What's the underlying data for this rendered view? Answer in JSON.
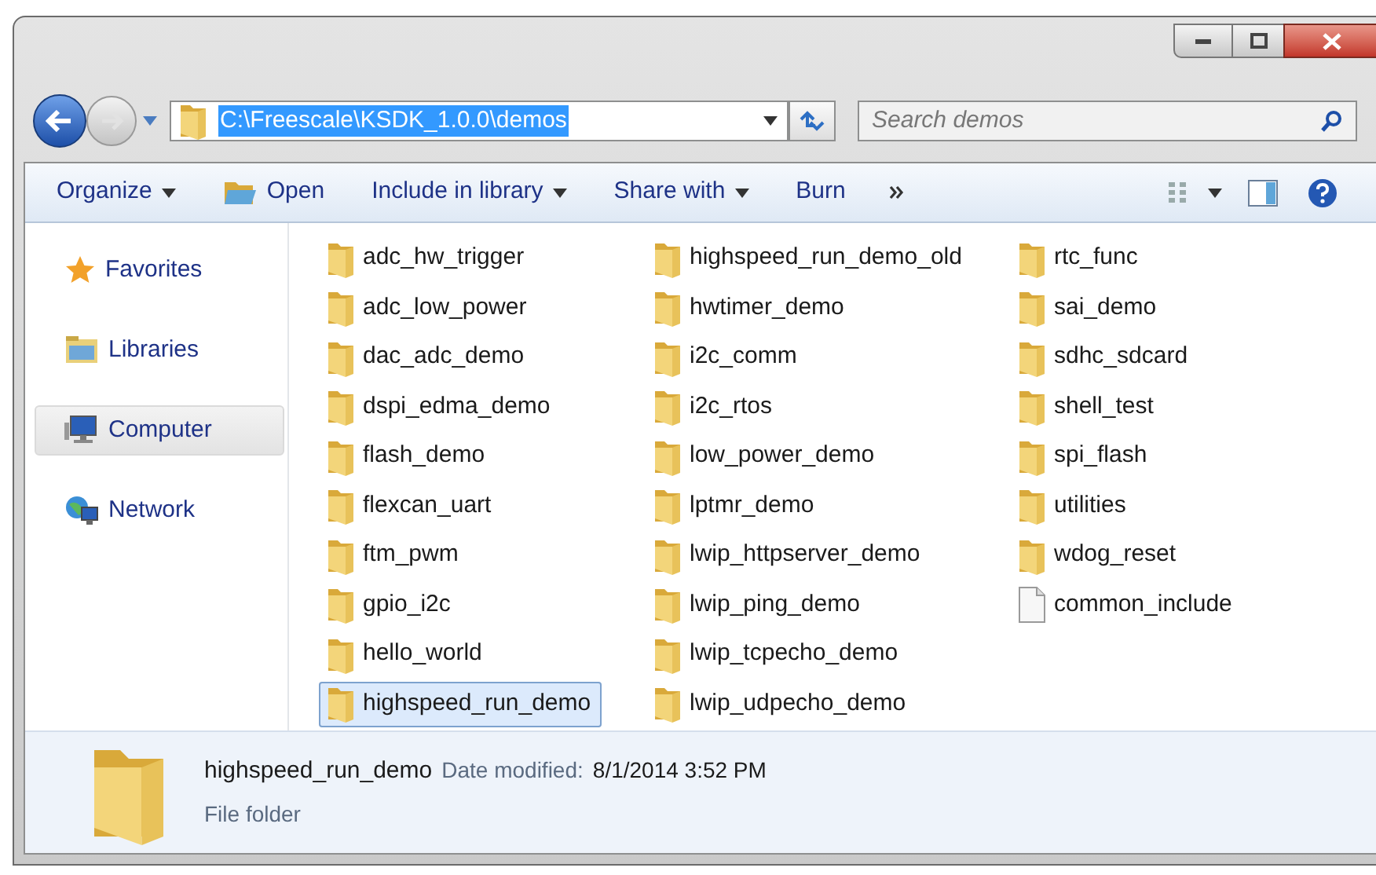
{
  "address": {
    "path": "C:\\Freescale\\KSDK_1.0.0\\demos"
  },
  "search": {
    "placeholder": "Search demos"
  },
  "toolbar": [
    {
      "label": "Organize",
      "dropdown": true,
      "icon": false
    },
    {
      "label": "Open",
      "dropdown": false,
      "icon": true
    },
    {
      "label": "Include in library",
      "dropdown": true,
      "icon": false
    },
    {
      "label": "Share with",
      "dropdown": true,
      "icon": false
    },
    {
      "label": "Burn",
      "dropdown": false,
      "icon": false
    }
  ],
  "sidebar": {
    "items": [
      {
        "label": "Favorites",
        "kind": "favorites",
        "selected": false
      },
      {
        "label": "Libraries",
        "kind": "libraries",
        "selected": false
      },
      {
        "label": "Computer",
        "kind": "computer",
        "selected": true
      },
      {
        "label": "Network",
        "kind": "network",
        "selected": false
      }
    ]
  },
  "files": [
    {
      "name": "adc_hw_trigger",
      "kind": "folder",
      "selected": false
    },
    {
      "name": "adc_low_power",
      "kind": "folder",
      "selected": false
    },
    {
      "name": "dac_adc_demo",
      "kind": "folder",
      "selected": false
    },
    {
      "name": "dspi_edma_demo",
      "kind": "folder",
      "selected": false
    },
    {
      "name": "flash_demo",
      "kind": "folder",
      "selected": false
    },
    {
      "name": "flexcan_uart",
      "kind": "folder",
      "selected": false
    },
    {
      "name": "ftm_pwm",
      "kind": "folder",
      "selected": false
    },
    {
      "name": "gpio_i2c",
      "kind": "folder",
      "selected": false
    },
    {
      "name": "hello_world",
      "kind": "folder",
      "selected": false
    },
    {
      "name": "highspeed_run_demo",
      "kind": "folder",
      "selected": true
    },
    {
      "name": "highspeed_run_demo_old",
      "kind": "folder",
      "selected": false
    },
    {
      "name": "hwtimer_demo",
      "kind": "folder",
      "selected": false
    },
    {
      "name": "i2c_comm",
      "kind": "folder",
      "selected": false
    },
    {
      "name": "i2c_rtos",
      "kind": "folder",
      "selected": false
    },
    {
      "name": "low_power_demo",
      "kind": "folder",
      "selected": false
    },
    {
      "name": "lptmr_demo",
      "kind": "folder",
      "selected": false
    },
    {
      "name": "lwip_httpserver_demo",
      "kind": "folder",
      "selected": false
    },
    {
      "name": "lwip_ping_demo",
      "kind": "folder",
      "selected": false
    },
    {
      "name": "lwip_tcpecho_demo",
      "kind": "folder",
      "selected": false
    },
    {
      "name": "lwip_udpecho_demo",
      "kind": "folder",
      "selected": false
    },
    {
      "name": "rtc_func",
      "kind": "folder",
      "selected": false
    },
    {
      "name": "sai_demo",
      "kind": "folder",
      "selected": false
    },
    {
      "name": "sdhc_sdcard",
      "kind": "folder",
      "selected": false
    },
    {
      "name": "shell_test",
      "kind": "folder",
      "selected": false
    },
    {
      "name": "spi_flash",
      "kind": "folder",
      "selected": false
    },
    {
      "name": "utilities",
      "kind": "folder",
      "selected": false
    },
    {
      "name": "wdog_reset",
      "kind": "folder",
      "selected": false
    },
    {
      "name": "common_include",
      "kind": "file",
      "selected": false
    }
  ],
  "details": {
    "name": "highspeed_run_demo",
    "date_label": "Date modified:",
    "date": "8/1/2014 3:52 PM",
    "type": "File folder"
  }
}
